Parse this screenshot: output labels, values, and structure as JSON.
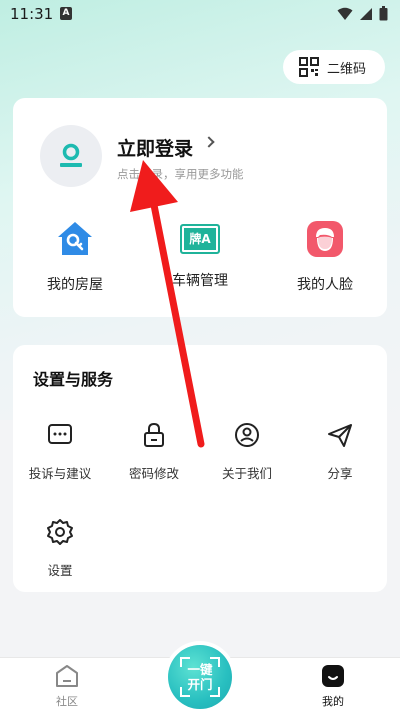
{
  "status_bar": {
    "time": "11:31",
    "notification_letter": "A"
  },
  "qr_button": {
    "label": "二维码",
    "icon": "qr-code-icon"
  },
  "profile": {
    "login_title": "立即登录",
    "login_subtitle": "点击登录，享用更多功能",
    "avatar_icon": "user-avatar-icon"
  },
  "quick_actions": [
    {
      "label": "我的房屋",
      "icon": "house-key-icon",
      "color": "#2f8be6"
    },
    {
      "label": "车辆管理",
      "icon": "license-plate-icon",
      "badge": "牌A",
      "color": "#1fb39a"
    },
    {
      "label": "我的人脸",
      "icon": "face-icon",
      "color": "#f2586b"
    }
  ],
  "settings": {
    "title": "设置与服务",
    "items": [
      {
        "label": "投诉与建议",
        "icon": "message-dots-icon"
      },
      {
        "label": "密码修改",
        "icon": "lock-icon"
      },
      {
        "label": "关于我们",
        "icon": "user-circle-icon"
      },
      {
        "label": "分享",
        "icon": "send-icon"
      },
      {
        "label": "设置",
        "icon": "gear-icon"
      }
    ]
  },
  "bottom_nav": {
    "community": "社区",
    "open_door_line1": "一键",
    "open_door_line2": "开门",
    "mine": "我的"
  },
  "colors": {
    "accent": "#27bfbf",
    "annotation_arrow": "#f01c1c"
  }
}
